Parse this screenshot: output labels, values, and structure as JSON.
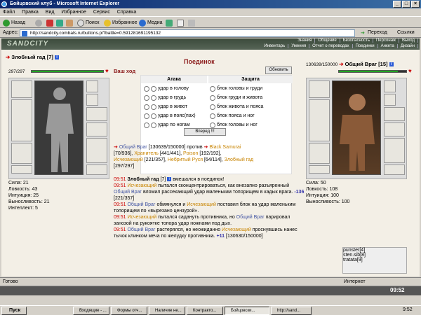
{
  "window": {
    "title": "Бойцовский клуб - Microsoft Internet Explorer"
  },
  "menu": [
    "Файл",
    "Правка",
    "Вид",
    "Избранное",
    "Сервис",
    "Справка"
  ],
  "toolbar": {
    "back": "Назад",
    "search": "Поиск",
    "favorites": "Избранное",
    "media": "Медиа"
  },
  "address": {
    "label": "Адрес:",
    "url": "http://sandcity.combats.ru/buttons.pl?battle=0.591281691195132",
    "go": "Переход",
    "links": "Ссылки"
  },
  "game": {
    "logo": "SANDCITY",
    "nav_top": [
      "Знания",
      "Общение",
      "Безопасность",
      "Персонаж",
      "Выход"
    ],
    "nav_bottom": [
      "Инвентарь",
      "Умения",
      "Отчет о переводах",
      "Поединки",
      "Анкета",
      "Дизайн"
    ]
  },
  "left_player": {
    "name": "Злобный гад",
    "level": "[7]",
    "hp_text": "297/297",
    "hp_frac": 1.0,
    "stats": [
      "Сила: 21",
      "Ловкость: 43",
      "Интуиция: 25",
      "Выносливость: 21",
      "Интеллект: 5"
    ]
  },
  "right_player": {
    "name": "Общий Враг",
    "level": "[15]",
    "hp_text": "130639/150000",
    "hp_frac": 0.87,
    "stats": [
      "Сила: 50",
      "Ловкость: 108",
      "Интуиция: 100",
      "Выносливость: 100"
    ]
  },
  "battle": {
    "title": "Поединок",
    "your_turn": "Ваш ход",
    "refresh": "Обновить",
    "attack_header": "Атака",
    "defense_header": "Защита",
    "attacks": [
      "удар в голову",
      "удар в грудь",
      "удар в живот",
      "удар в пояс(пах)",
      "удар по ногам"
    ],
    "defenses": [
      "блок головы и груди",
      "блок груди и живота",
      "блок живота и пояса",
      "блок пояса и ног",
      "блок головы и ног"
    ],
    "forward": "Вперед !!!"
  },
  "versus": {
    "p1": "Общий Враг",
    "p1_hp": "[130639/150000]",
    "against": "против",
    "p2": "Black Samurai",
    "line2a": "[70/936],",
    "line2b": "Хранитель",
    "line2c": "[441/441],",
    "line2d": "Poison",
    "line2e": "[192/192],",
    "line3a": "Исчезающий",
    "line3b": "[221/357],",
    "line3c": "Небритый Руся",
    "line3d": "[64/114],",
    "line3e": "Злобный гад",
    "line4": "[297/297]"
  },
  "log": [
    {
      "time": "09:51",
      "a": "Злобный гад",
      "b": "[7]",
      "c": "вмешался в поединок!"
    },
    {
      "time": "09:51",
      "a": "Исчезающий",
      "text": "пытался сконцентрироваться, как внезапно разъяренный",
      "b": "Общий Враг",
      "text2": "вломил рассекающий удар маленьким топорищем в кадык врага.",
      "dmg": "-136",
      "hp": "[221/357]"
    },
    {
      "time": "09:51",
      "a": "Общий Враг",
      "text": "обмянулся и",
      "b": "Исчезающий",
      "text2": "поставил блок на удар маленьким топорищем по «вырезано цензурой»."
    },
    {
      "time": "09:51",
      "a": "Исчезающий",
      "text": "пытался садануть противника, но",
      "b": "Общий Враг",
      "text2": "парировал занозой на рукоятке топора удар ножнами под дых."
    },
    {
      "time": "09:51",
      "a": "Общий Враг",
      "text": "растерялся, но неожиданно",
      "b": "Исчезающий",
      "text2": "проснувшись нанес тычок клинком меча по желудку противника.",
      "dmg": "+11",
      "hp": "[130630/150000]"
    }
  ],
  "chat": [
    "punster",
    "sten.sib",
    "tratata"
  ],
  "chat_levels": [
    "[4]",
    "[8]",
    "[9]"
  ],
  "status": {
    "left": "Готово",
    "right": "Интернет"
  },
  "clock": "09:52",
  "taskbar": {
    "start": "Пуск",
    "tasks": [
      "Входящие - ...",
      "Формы отч...",
      "Наличие не...",
      "Контракто...",
      "Бойцовски...",
      "http://sand..."
    ],
    "active_index": 4,
    "time": "9:52"
  }
}
